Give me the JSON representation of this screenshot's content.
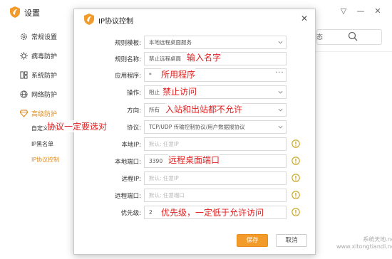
{
  "app": {
    "title": "设置"
  },
  "sidebar": {
    "items": [
      {
        "label": "常规设置",
        "icon": "gear-icon"
      },
      {
        "label": "病毒防护",
        "icon": "virus-icon"
      },
      {
        "label": "系统防护",
        "icon": "system-icon"
      },
      {
        "label": "网络防护",
        "icon": "globe-icon"
      },
      {
        "label": "高级防护",
        "icon": "diamond-icon"
      }
    ],
    "sub_items": [
      "自定义防护",
      "IP黑名单",
      "IP协议控制"
    ]
  },
  "background": {
    "search_label": "态"
  },
  "dialog": {
    "title": "IP协议控制",
    "fields": {
      "template": {
        "label": "规则模板:",
        "value": "本地远程桌面服务"
      },
      "name": {
        "label": "规则名称:",
        "value": "禁止远程桌面"
      },
      "app": {
        "label": "应用程序:",
        "value": "*"
      },
      "action": {
        "label": "操作:",
        "value": "阻止"
      },
      "direction": {
        "label": "方向:",
        "value": "所有"
      },
      "protocol": {
        "label": "协议:",
        "value": "TCP/UDP 传输控制协议/用户数据报协议"
      },
      "local_ip": {
        "label": "本地IP:",
        "placeholder": "默认: 任意IP"
      },
      "local_port": {
        "label": "本地端口:",
        "value": "3390"
      },
      "remote_ip": {
        "label": "远程IP:",
        "placeholder": "默认: 任意IP"
      },
      "remote_port": {
        "label": "远程端口:",
        "placeholder": "默认: 任意端口"
      },
      "priority": {
        "label": "优先级:",
        "value": "2"
      }
    },
    "save_label": "保存",
    "cancel_label": "取消"
  },
  "annotations": {
    "name": "输入名字",
    "app": "所用程序",
    "action": "禁止访问",
    "direction": "入站和出站都不允许",
    "protocol": "协议一定要选对",
    "local_port": "远程桌面端口",
    "priority": "优先级，一定低于允许访问"
  },
  "watermark": {
    "line1": "系统天地.net",
    "line2": "www.xitongtiandi.net"
  },
  "colors": {
    "accent": "#f39b2a",
    "annotation": "#e02020",
    "active_nav": "#e08a1c"
  }
}
